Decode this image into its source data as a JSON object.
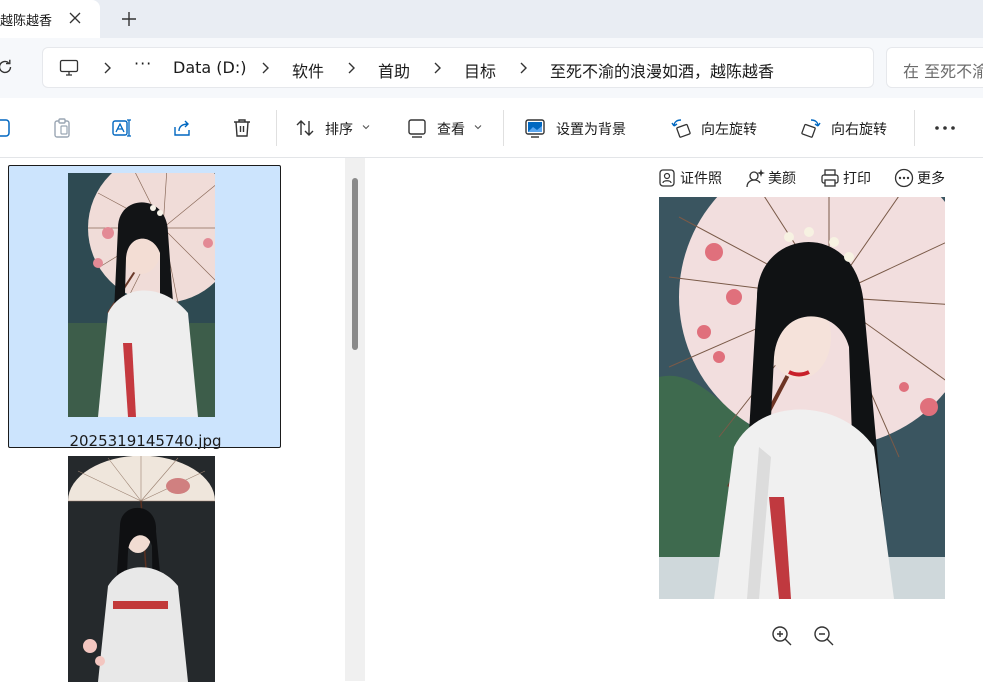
{
  "tab": {
    "title": "越陈越香",
    "close_icon": "close-icon",
    "new_tab_icon": "plus-icon"
  },
  "address": {
    "refresh_icon": "refresh-icon",
    "root_icon": "computer-icon",
    "overflow": "···",
    "crumbs": [
      "Data (D:)",
      "软件",
      "首助",
      "目标",
      "至死不渝的浪漫如酒，越陈越香"
    ]
  },
  "search": {
    "placeholder": "在 至死不渝"
  },
  "commands": {
    "new_icon": "new-item-icon",
    "copy_icon": "clipboard-icon",
    "rename_icon": "rename-icon",
    "share_icon": "share-icon",
    "delete_icon": "trash-icon",
    "sort_label": "排序",
    "view_label": "查看",
    "set_background_label": "设置为背景",
    "rotate_left_label": "向左旋转",
    "rotate_right_label": "向右旋转",
    "more_icon": "more-icon"
  },
  "files": [
    {
      "name": "2025319145740.jpg",
      "selected": true
    },
    {
      "name": "",
      "selected": false
    }
  ],
  "preview": {
    "actions": [
      {
        "label": "证件照",
        "icon": "id-photo-icon"
      },
      {
        "label": "美颜",
        "icon": "beauty-icon"
      },
      {
        "label": "打印",
        "icon": "printer-icon"
      },
      {
        "label": "更多",
        "icon": "more-circle-icon"
      }
    ],
    "zoom_in_icon": "zoom-in-icon",
    "zoom_out_icon": "zoom-out-icon"
  },
  "colors": {
    "selection": "#cce4fd",
    "accent": "#0067c0",
    "tabbar": "#e9edf3"
  }
}
